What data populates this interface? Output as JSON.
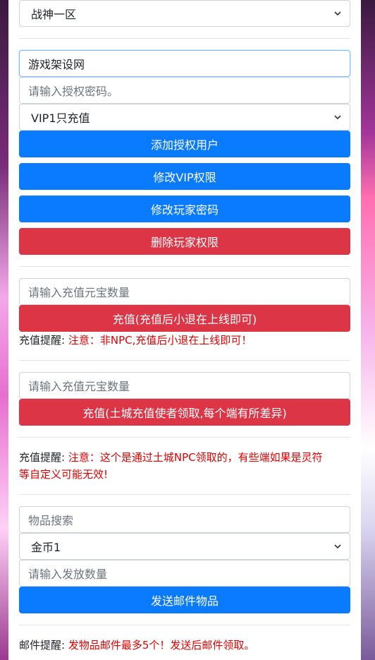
{
  "server_select": {
    "value": "战神一区",
    "icon": "chevron-down-icon"
  },
  "auth": {
    "account_value": "游戏架设网",
    "password_placeholder": "请输入授权密码。",
    "vip_select_value": "VIP1只充值",
    "add_button": "添加授权用户",
    "modify_vip_button": "修改VIP权限",
    "modify_password_button": "修改玩家密码",
    "delete_button": "删除玩家权限"
  },
  "recharge1": {
    "placeholder": "请输入充值元宝数量",
    "button": "充值(充值后小退在上线即可)",
    "tip_label": "充值提醒:",
    "tip_text": "注意：非NPC,充值后小退在上线即可！"
  },
  "recharge2": {
    "placeholder": "请输入充值元宝数量",
    "button": "充值(土城充值使者领取,每个端有所差异)",
    "tip_label": "充值提醒:",
    "tip_text_1": "注意：这个是通过土城NPC领取的，有些端如果是灵符",
    "tip_text_2": "等自定义可能无效!"
  },
  "mail": {
    "search_placeholder": "物品搜索",
    "item_select_value": "金币1",
    "quantity_placeholder": "请输入发放数量",
    "send_button": "发送邮件物品",
    "tip_label": "邮件提醒:",
    "tip_text": "发物品邮件最多5个！发送后邮件领取。"
  },
  "colors": {
    "primary": "#0a7bff",
    "danger": "#dc3545",
    "warning_text": "#e30000"
  }
}
